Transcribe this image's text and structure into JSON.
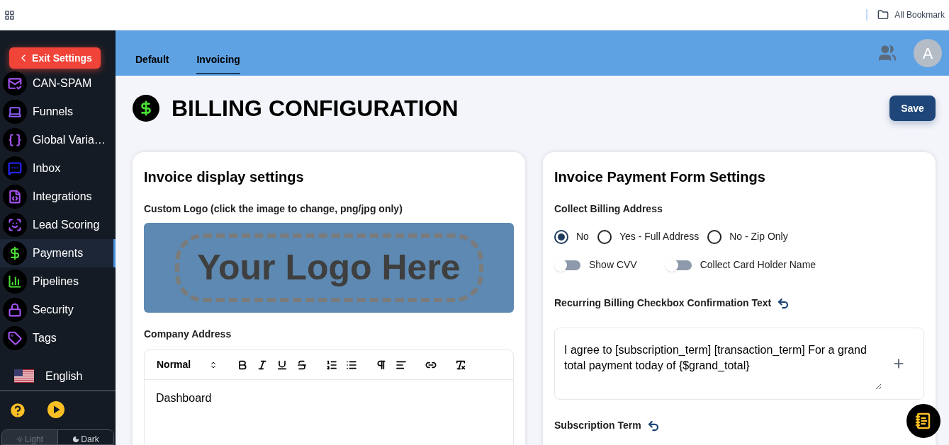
{
  "browser_bar": {
    "bookmarks": "All Bookmark"
  },
  "sidebar": {
    "exit_button": "Exit Settings",
    "items": [
      {
        "label": "CAN-SPAM",
        "selected": false
      },
      {
        "label": "Funnels",
        "selected": false
      },
      {
        "label": "Global Varia…",
        "selected": false
      },
      {
        "label": "Inbox",
        "selected": false
      },
      {
        "label": "Integrations",
        "selected": false
      },
      {
        "label": "Lead Scoring",
        "selected": false
      },
      {
        "label": "Payments",
        "selected": true
      },
      {
        "label": "Pipelines",
        "selected": false
      },
      {
        "label": "Security",
        "selected": false
      },
      {
        "label": "Tags",
        "selected": false
      }
    ],
    "language": "English",
    "theme_options": [
      {
        "label": "Light",
        "selected": false
      },
      {
        "label": "Dark",
        "selected": true
      }
    ]
  },
  "header": {
    "tabs": [
      {
        "label": "Default",
        "selected": false
      },
      {
        "label": "Invoicing",
        "selected": true
      }
    ],
    "avatar": "A"
  },
  "page": {
    "title": "BILLING CONFIGURATION",
    "save": "Save"
  },
  "display_settings": {
    "title": "Invoice display settings",
    "logo_label": "Custom Logo (click the image to change, png/jpg only)",
    "logo_text": "Your Logo Here",
    "address_label": "Company Address",
    "format": "Normal",
    "address_value": "Dashboard"
  },
  "payment_form": {
    "title": "Invoice Payment Form Settings",
    "billing_label": "Collect Billing Address",
    "radios": [
      {
        "label": "No",
        "selected": true
      },
      {
        "label": "Yes - Full Address",
        "selected": false
      },
      {
        "label": "No - Zip Only",
        "selected": false
      }
    ],
    "toggles": [
      {
        "label": "Show CVV",
        "on": false
      },
      {
        "label": "Collect Card Holder Name",
        "on": false
      }
    ],
    "confirmation_label": "Recurring Billing Checkbox Confirmation Text",
    "confirmation_value": "I agree to [subscription_term] [transaction_term] For a grand total payment today of {$grand_total}",
    "term_label": "Subscription Term"
  }
}
